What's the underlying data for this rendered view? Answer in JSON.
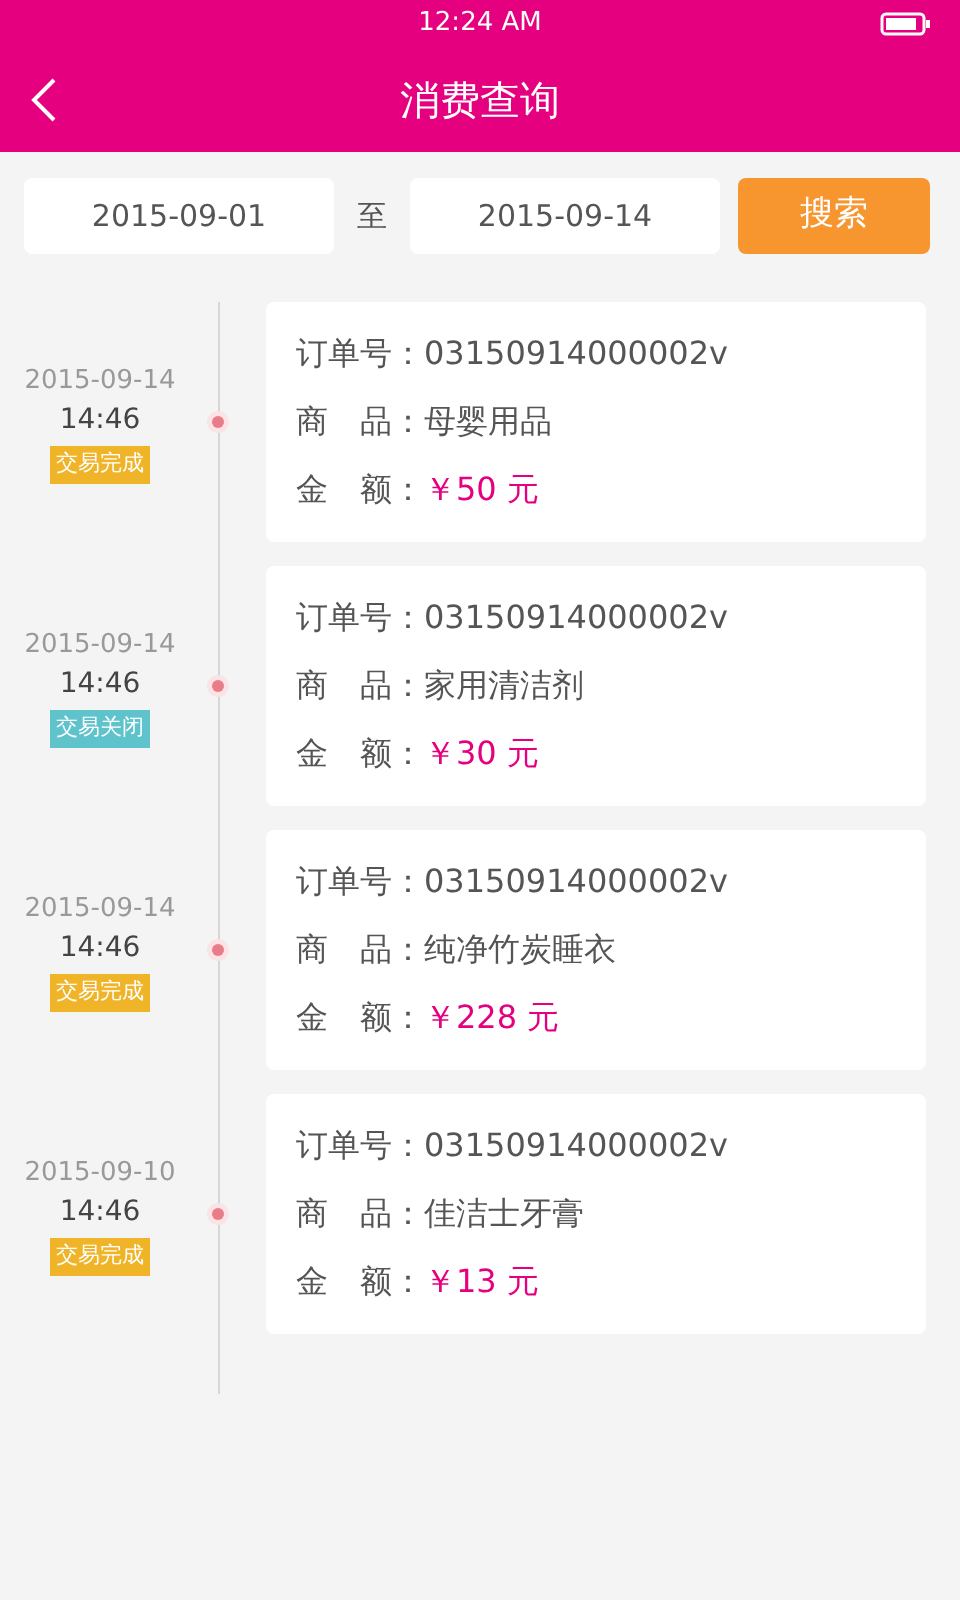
{
  "status_bar": {
    "time": "12:24 AM"
  },
  "header": {
    "title": "消费查询"
  },
  "search": {
    "from": "2015-09-01",
    "separator": "至",
    "to": "2015-09-14",
    "button": "搜索"
  },
  "orders": [
    {
      "date": "2015-09-14",
      "time": "14:46",
      "status": "交易完成",
      "color": "#f0b429",
      "order_label": "订单号：",
      "order_no": "03150914000002v",
      "product_label": "商　品：",
      "product": "母婴用品",
      "amount_label": "金　额：",
      "amount": "￥50 元"
    },
    {
      "date": "2015-09-14",
      "time": "14:46",
      "status": "交易关闭",
      "color": "#5fc3cc",
      "order_label": "订单号：",
      "order_no": "03150914000002v",
      "product_label": "商　品：",
      "product": "家用清洁剂",
      "amount_label": "金　额：",
      "amount": "￥30 元"
    },
    {
      "date": "2015-09-14",
      "time": "14:46",
      "status": "交易完成",
      "color": "#f0b429",
      "order_label": "订单号：",
      "order_no": "03150914000002v",
      "product_label": "商　品：",
      "product": "纯净竹炭睡衣",
      "amount_label": "金　额：",
      "amount": "￥228 元"
    },
    {
      "date": "2015-09-10",
      "time": "14:46",
      "status": "交易完成",
      "color": "#f0b429",
      "order_label": "订单号：",
      "order_no": "03150914000002v",
      "product_label": "商　品：",
      "product": "佳洁士牙膏",
      "amount_label": "金　额：",
      "amount": "￥13 元"
    }
  ]
}
